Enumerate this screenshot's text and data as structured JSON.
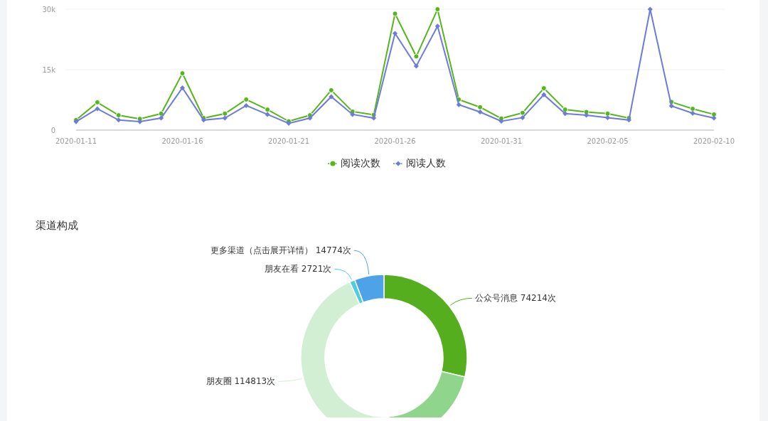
{
  "trend_chart": {
    "chart_data": {
      "type": "line",
      "x": [
        "2020-01-11",
        "2020-01-12",
        "2020-01-13",
        "2020-01-14",
        "2020-01-15",
        "2020-01-16",
        "2020-01-17",
        "2020-01-18",
        "2020-01-19",
        "2020-01-20",
        "2020-01-21",
        "2020-01-22",
        "2020-01-23",
        "2020-01-24",
        "2020-01-25",
        "2020-01-26",
        "2020-01-27",
        "2020-01-28",
        "2020-01-29",
        "2020-01-30",
        "2020-01-31",
        "2020-02-01",
        "2020-02-02",
        "2020-02-03",
        "2020-02-04",
        "2020-02-05",
        "2020-02-06",
        "2020-02-07",
        "2020-02-08",
        "2020-02-09",
        "2020-02-10"
      ],
      "xticks": [
        {
          "value": "2020-01-11",
          "label": "2020-01-11"
        },
        {
          "value": "2020-01-16",
          "label": "2020-01-16"
        },
        {
          "value": "2020-01-21",
          "label": "2020-01-21"
        },
        {
          "value": "2020-01-26",
          "label": "2020-01-26"
        },
        {
          "value": "2020-01-31",
          "label": "2020-01-31"
        },
        {
          "value": "2020-02-05",
          "label": "2020-02-05"
        },
        {
          "value": "2020-02-10",
          "label": "2020-02-10"
        }
      ],
      "yticks": [
        {
          "value": 0,
          "label": "0"
        },
        {
          "value": 15000,
          "label": "15k"
        },
        {
          "value": 30000,
          "label": "30k"
        }
      ],
      "xlim": [
        "2020-01-11",
        "2020-02-10"
      ],
      "ylim": [
        0,
        30000
      ],
      "series": [
        {
          "name": "阅读次数",
          "color": "#57b51c",
          "marker": "circle",
          "values": [
            2500,
            6900,
            3700,
            2800,
            4100,
            14100,
            3000,
            4100,
            7600,
            5100,
            2200,
            3700,
            9900,
            4600,
            3800,
            28900,
            18300,
            30000,
            7600,
            5700,
            2900,
            4300,
            10400,
            5100,
            4500,
            4100,
            3000,
            null,
            7000,
            5300,
            3900
          ]
        },
        {
          "name": "阅读人数",
          "color": "#6c7cd9",
          "marker": "diamond",
          "values": [
            2100,
            5300,
            2500,
            2100,
            3000,
            10500,
            2500,
            3000,
            6100,
            3900,
            1700,
            3000,
            8300,
            3900,
            3000,
            24000,
            15900,
            25800,
            6300,
            4500,
            2200,
            3100,
            8800,
            4100,
            3700,
            3100,
            2500,
            30000,
            6000,
            4200,
            3000
          ]
        }
      ]
    }
  },
  "channel_section": {
    "title": "渠道构成",
    "chart_data": {
      "type": "donut",
      "values": [
        74214,
        51878,
        114813,
        2721,
        14774
      ],
      "value_labels": [
        "公众号消息 74214次",
        null,
        "朋友圈 114813次",
        "朋友在看 2721次",
        "更多渠道（点击展开详情） 14774次"
      ],
      "colors": [
        "#54ae1e",
        "#8fd68c",
        "#d2efd3",
        "#4fcde0",
        "#4ea3e8"
      ]
    }
  }
}
